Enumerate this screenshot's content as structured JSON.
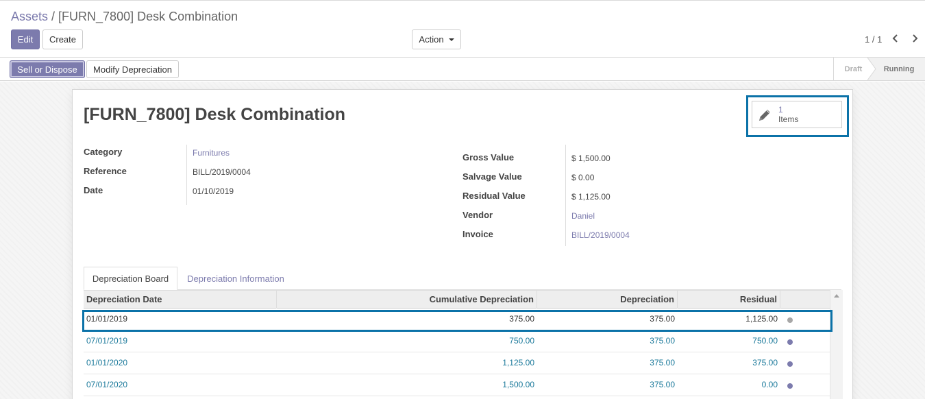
{
  "breadcrumb": {
    "parent": "Assets",
    "separator": "/",
    "current": "[FURN_7800] Desk Combination"
  },
  "toolbar": {
    "edit_label": "Edit",
    "create_label": "Create",
    "action_label": "Action"
  },
  "pager": {
    "value": "1 / 1"
  },
  "statusbar": {
    "sell_label": "Sell or Dispose",
    "modify_label": "Modify Depreciation",
    "stages": [
      "Draft",
      "Running"
    ],
    "active_stage": "Running"
  },
  "record": {
    "title": "[FURN_7800] Desk Combination",
    "smart_button": {
      "count": "1",
      "label": "Items",
      "icon": "pencil-icon"
    },
    "left_fields": [
      {
        "label": "Category",
        "value": "Furnitures",
        "link": true
      },
      {
        "label": "Reference",
        "value": "BILL/2019/0004",
        "link": false
      },
      {
        "label": "Date",
        "value": "01/10/2019",
        "link": false
      }
    ],
    "right_fields": [
      {
        "label": "Gross Value",
        "value": "$ 1,500.00",
        "link": false
      },
      {
        "label": "Salvage Value",
        "value": "$ 0.00",
        "link": false
      },
      {
        "label": "Residual Value",
        "value": "$ 1,125.00",
        "link": false
      },
      {
        "label": "Vendor",
        "value": "Daniel",
        "link": true
      },
      {
        "label": "Invoice",
        "value": "BILL/2019/0004",
        "link": true
      }
    ]
  },
  "tabs": [
    {
      "label": "Depreciation Board",
      "active": true
    },
    {
      "label": "Depreciation Information",
      "active": false
    }
  ],
  "table": {
    "columns": [
      "Depreciation Date",
      "Cumulative Depreciation",
      "Depreciation",
      "Residual"
    ],
    "rows": [
      {
        "date": "01/01/2019",
        "cumulative": "375.00",
        "depreciation": "375.00",
        "residual": "1,125.00",
        "status": "posted"
      },
      {
        "date": "07/01/2019",
        "cumulative": "750.00",
        "depreciation": "375.00",
        "residual": "750.00",
        "status": "pending"
      },
      {
        "date": "01/01/2020",
        "cumulative": "1,125.00",
        "depreciation": "375.00",
        "residual": "375.00",
        "status": "pending"
      },
      {
        "date": "07/01/2020",
        "cumulative": "1,500.00",
        "depreciation": "375.00",
        "residual": "0.00",
        "status": "pending"
      }
    ]
  },
  "colors": {
    "brand": "#7c7bad",
    "link_teal": "#19789a",
    "highlight": "#0b72a8"
  }
}
